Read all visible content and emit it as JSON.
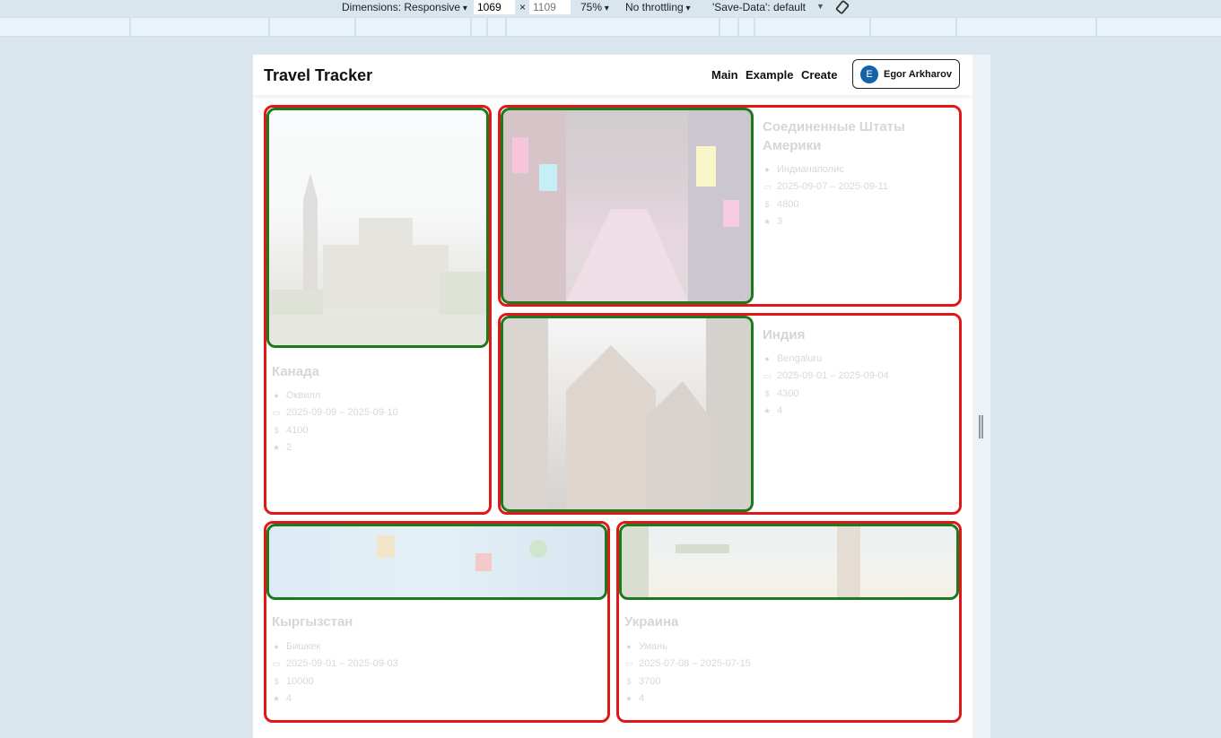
{
  "devtools": {
    "dimensions_label": "Dimensions: Responsive",
    "width_value": "1069",
    "times": "×",
    "height_value": "1109",
    "zoom": "75%",
    "throttling": "No throttling",
    "save_data": "'Save-Data': default",
    "rotate_icon": "rotate-icon"
  },
  "header": {
    "brand": "Travel Tracker",
    "nav": [
      "Main",
      "Example",
      "Create"
    ],
    "user": {
      "initial": "E",
      "name": "Egor Arkharov"
    }
  },
  "cards": [
    {
      "country": "Канада",
      "city": "Оквилл",
      "dates": "2025-09-09 – 2025-09-10",
      "cost": "4100",
      "rating": "2"
    },
    {
      "country": "Соединенные Штаты Америки",
      "city": "Индианаполис",
      "dates": "2025-09-07 – 2025-09-11",
      "cost": "4800",
      "rating": "3"
    },
    {
      "country": "Индия",
      "city": "Bengaluru",
      "dates": "2025-09-01 – 2025-09-04",
      "cost": "4300",
      "rating": "4"
    },
    {
      "country": "Кыргызстан",
      "city": "Бишкек",
      "dates": "2025-09-01 – 2025-09-03",
      "cost": "10000",
      "rating": "4"
    },
    {
      "country": "Украина",
      "city": "Умань",
      "dates": "2025-07-08 – 2025-07-15",
      "cost": "3700",
      "rating": "4"
    }
  ],
  "icons": {
    "city": "location-icon",
    "dates": "calendar-icon",
    "cost": "dollar-icon",
    "rating": "star-icon"
  },
  "colors": {
    "card_border": "#e01818",
    "image_border": "#1c7a1c",
    "avatar": "#1463a8"
  }
}
